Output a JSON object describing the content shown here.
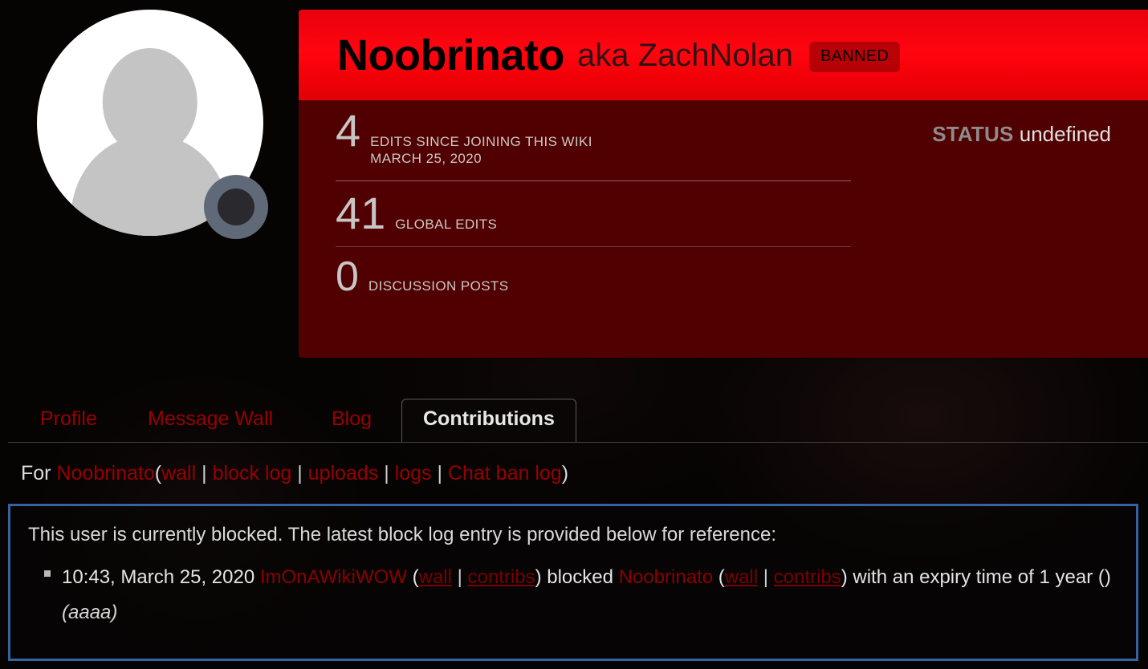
{
  "profile": {
    "display_name": "Noobrinato",
    "aka_prefix": "aka",
    "aka_name": "ZachNolan",
    "aka_full": "aka ZachNolan",
    "banned_badge": "BANNED",
    "avatar_alt": "default-user-avatar",
    "stats": [
      {
        "key": "edits-since-joining",
        "number": "4",
        "label_line1": "EDITS SINCE JOINING THIS WIKI",
        "label_line2": "MARCH 25, 2020"
      },
      {
        "key": "global-edits",
        "number": "41",
        "label_line1": "GLOBAL EDITS",
        "label_line2": ""
      },
      {
        "key": "discussion-posts",
        "number": "0",
        "label_line1": "DISCUSSION POSTS",
        "label_line2": ""
      }
    ],
    "status": {
      "label": "STATUS",
      "value": "undefined"
    }
  },
  "tabs": [
    {
      "key": "profile",
      "label": "Profile",
      "active": false
    },
    {
      "key": "message-wall",
      "label": "Message Wall",
      "active": false
    },
    {
      "key": "blog",
      "label": "Blog",
      "active": false
    },
    {
      "key": "contributions",
      "label": "Contributions",
      "active": true
    }
  ],
  "contributions_header": {
    "for_word": "For",
    "user": "Noobrinato",
    "open_paren": "(",
    "close_paren": ")",
    "links": [
      {
        "key": "wall",
        "label": "wall"
      },
      {
        "key": "block-log",
        "label": "block log"
      },
      {
        "key": "uploads",
        "label": "uploads"
      },
      {
        "key": "logs",
        "label": "logs"
      },
      {
        "key": "chat-ban-log",
        "label": "Chat ban log"
      }
    ],
    "separator": "|"
  },
  "block_notice": {
    "border_color": "#36629f",
    "message": "This user is currently blocked. The latest block log entry is provided below for reference:",
    "entry": {
      "timestamp": "10:43, March 25, 2020",
      "admin": "ImOnAWikiWOW",
      "admin_links": [
        {
          "key": "wall",
          "label": "wall"
        },
        {
          "key": "contribs",
          "label": "contribs"
        }
      ],
      "action": "blocked",
      "target": "Noobrinato",
      "target_links": [
        {
          "key": "wall",
          "label": "wall"
        },
        {
          "key": "contribs",
          "label": "contribs"
        }
      ],
      "expiry_text": "with an expiry time of 1 year ()",
      "reason": "(aaaa)",
      "separator": "|",
      "open_paren": "(",
      "close_paren": ")"
    }
  },
  "colors": {
    "banner_red": "#ff0510",
    "card_maroon": "#500000",
    "link_red": "#990000",
    "notice_border_blue": "#36629f",
    "page_background": "#060303"
  }
}
